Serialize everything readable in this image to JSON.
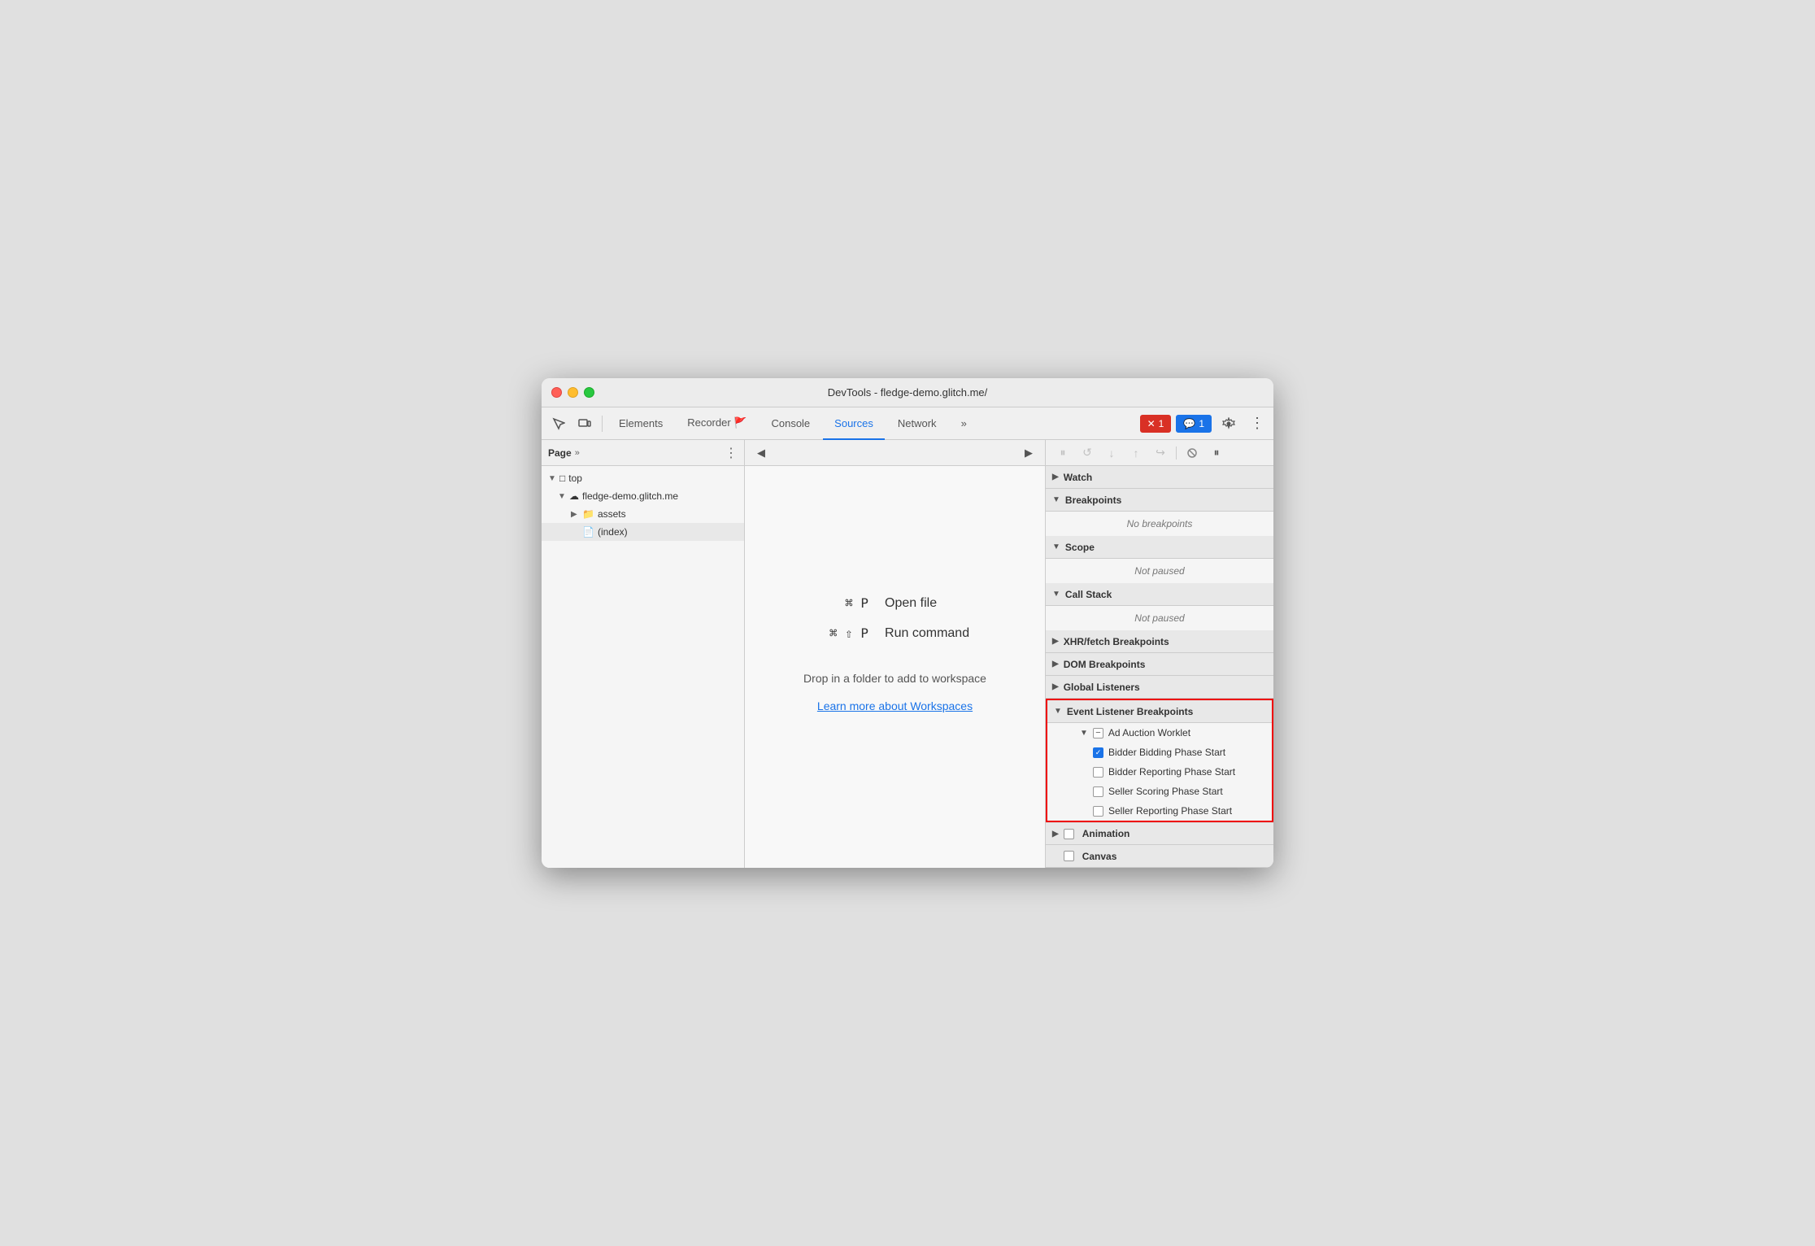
{
  "window": {
    "title": "DevTools - fledge-demo.glitch.me/"
  },
  "toolbar": {
    "tabs": [
      {
        "id": "elements",
        "label": "Elements",
        "active": false
      },
      {
        "id": "recorder",
        "label": "Recorder 🚩",
        "active": false
      },
      {
        "id": "console",
        "label": "Console",
        "active": false
      },
      {
        "id": "sources",
        "label": "Sources",
        "active": true
      },
      {
        "id": "network",
        "label": "Network",
        "active": false
      }
    ],
    "more_tabs": "»",
    "errors_count": "1",
    "messages_count": "1"
  },
  "left_panel": {
    "label": "Page",
    "chevron": "»",
    "tree": {
      "top": "top",
      "domain": "fledge-demo.glitch.me",
      "assets_folder": "assets",
      "index_file": "(index)"
    }
  },
  "middle_panel": {
    "shortcuts": [
      {
        "key": "⌘ P",
        "label": "Open file"
      },
      {
        "key": "⌘ ⇧ P",
        "label": "Run command"
      }
    ],
    "workspace_text": "Drop in a folder to add to workspace",
    "workspace_link": "Learn more about Workspaces"
  },
  "right_panel": {
    "sections": [
      {
        "id": "watch",
        "label": "Watch",
        "expanded": false
      },
      {
        "id": "breakpoints",
        "label": "Breakpoints",
        "expanded": true,
        "empty_text": "No breakpoints"
      },
      {
        "id": "scope",
        "label": "Scope",
        "expanded": true,
        "empty_text": "Not paused"
      },
      {
        "id": "call-stack",
        "label": "Call Stack",
        "expanded": true,
        "empty_text": "Not paused"
      },
      {
        "id": "xhr-fetch",
        "label": "XHR/fetch Breakpoints",
        "expanded": false
      },
      {
        "id": "dom",
        "label": "DOM Breakpoints",
        "expanded": false
      },
      {
        "id": "global-listeners",
        "label": "Global Listeners",
        "expanded": false
      },
      {
        "id": "event-listener-breakpoints",
        "label": "Event Listener Breakpoints",
        "expanded": true,
        "highlighted": true,
        "sub_items": [
          {
            "id": "ad-auction-worklet",
            "label": "Ad Auction Worklet",
            "expanded": true,
            "minus": true,
            "breakpoints": [
              {
                "id": "bidder-bidding-phase-start",
                "label": "Bidder Bidding Phase Start",
                "checked": true
              },
              {
                "id": "bidder-reporting-phase-start",
                "label": "Bidder Reporting Phase Start",
                "checked": false
              },
              {
                "id": "seller-scoring-phase-start",
                "label": "Seller Scoring Phase Start",
                "checked": false
              },
              {
                "id": "seller-reporting-phase-start",
                "label": "Seller Reporting Phase Start",
                "checked": false
              }
            ]
          }
        ]
      },
      {
        "id": "animation",
        "label": "Animation",
        "expanded": false
      },
      {
        "id": "canvas",
        "label": "Canvas",
        "expanded": false
      }
    ]
  }
}
